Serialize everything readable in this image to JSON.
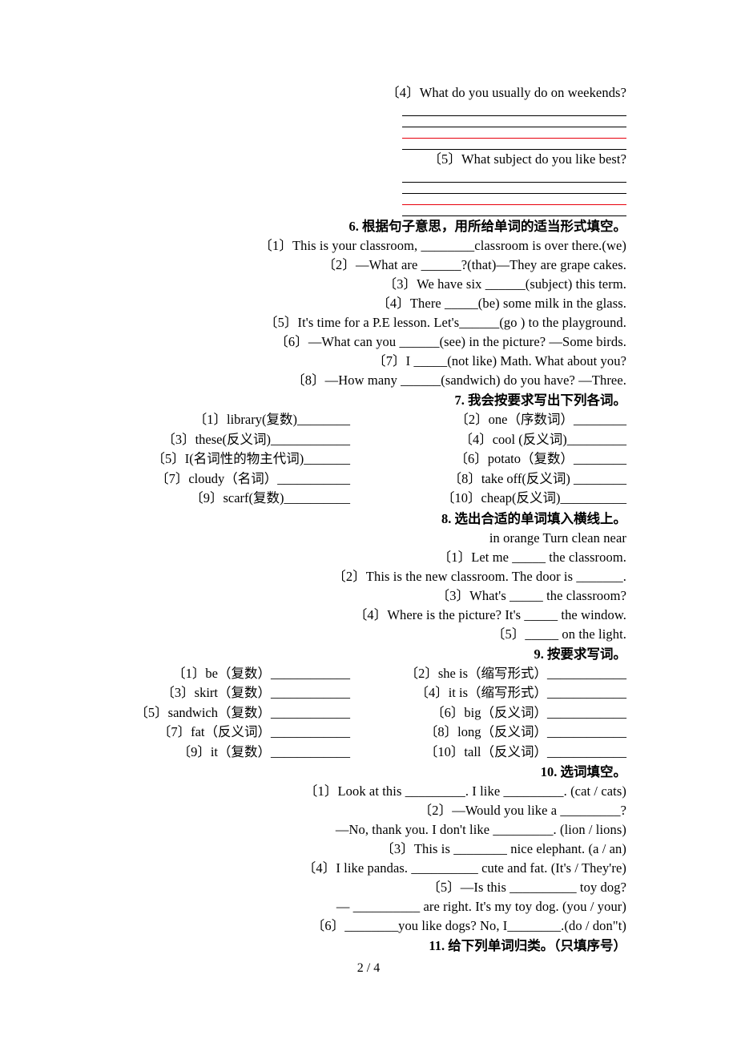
{
  "document": {
    "page_footer": "2 / 4",
    "rule_colors": {
      "ink": "#000000",
      "accent_red": "#e8000c"
    }
  },
  "carryover": {
    "q4": "〔4〕What do you usually do on weekends?",
    "q5": "〔5〕What subject do you like best?"
  },
  "sections": [
    {
      "id": "s6",
      "heading": "6. 根据句子意思，用所给单词的适当形式填空。",
      "items": [
        "〔1〕This is your classroom, ________classroom is over there.(we)",
        "〔2〕—What are ______?(that)—They are grape cakes.",
        "〔3〕We have six ______(subject) this term.",
        "〔4〕There _____(be) some milk in the glass.",
        "〔5〕It's time for a P.E lesson. Let's______(go ) to the playground.",
        "〔6〕—What can you ______(see) in the picture? —Some birds.",
        "〔7〕I _____(not like) Math. What about you?",
        "〔8〕—How many ______(sandwich) do you have? —Three."
      ]
    },
    {
      "id": "s7",
      "heading": "7. 我会按要求写出下列各词。",
      "cells": [
        "〔1〕library(复数)________",
        "〔2〕one（序数词）________",
        "〔3〕these(反义词)____________",
        "〔4〕cool (反义词)_________",
        "〔5〕I(名词性的物主代词)_______",
        "〔6〕potato（复数）________",
        "〔7〕cloudy（名词）___________",
        "〔8〕take off(反义词) ________",
        "〔9〕scarf(复数)__________",
        "〔10〕cheap(反义词)__________"
      ]
    },
    {
      "id": "s8",
      "heading": "8. 选出合适的单词填入横线上。",
      "wordbank": "in orange   Turn   clean near",
      "items": [
        "〔1〕Let me _____ the classroom.",
        "〔2〕This is the new classroom. The door is _______.",
        "〔3〕What's _____ the classroom?",
        "〔4〕Where is the picture? It's _____ the window.",
        "〔5〕_____ on the light."
      ]
    },
    {
      "id": "s9",
      "heading": "9. 按要求写词。",
      "cells": [
        "〔1〕be（复数）____________",
        "〔2〕she is（缩写形式）____________",
        "〔3〕skirt（复数）____________",
        "〔4〕it is（缩写形式）____________",
        "〔5〕sandwich（复数）____________",
        "〔6〕big（反义词）____________",
        "〔7〕fat（反义词）____________",
        "〔8〕long（反义词）____________",
        "〔9〕it（复数）____________",
        "〔10〕tall（反义词）____________"
      ]
    },
    {
      "id": "s10",
      "heading": "10. 选词填空。",
      "items": [
        "〔1〕Look at this _________. I like _________.  (cat / cats)",
        "〔2〕—Would you like a _________?",
        "—No, thank you. I don't like _________. (lion / lions)",
        "〔3〕This is ________ nice elephant.  (a / an)",
        "〔4〕I like pandas. __________ cute and fat.  (It's / They're)",
        "〔5〕—Is this __________ toy dog?",
        "— __________ are right. It's my toy dog.  (you / your)",
        "〔6〕________you like dogs? No, I________.(do / don\"t)"
      ]
    },
    {
      "id": "s11",
      "heading": "11. 给下列单词归类。（只填序号）"
    }
  ]
}
